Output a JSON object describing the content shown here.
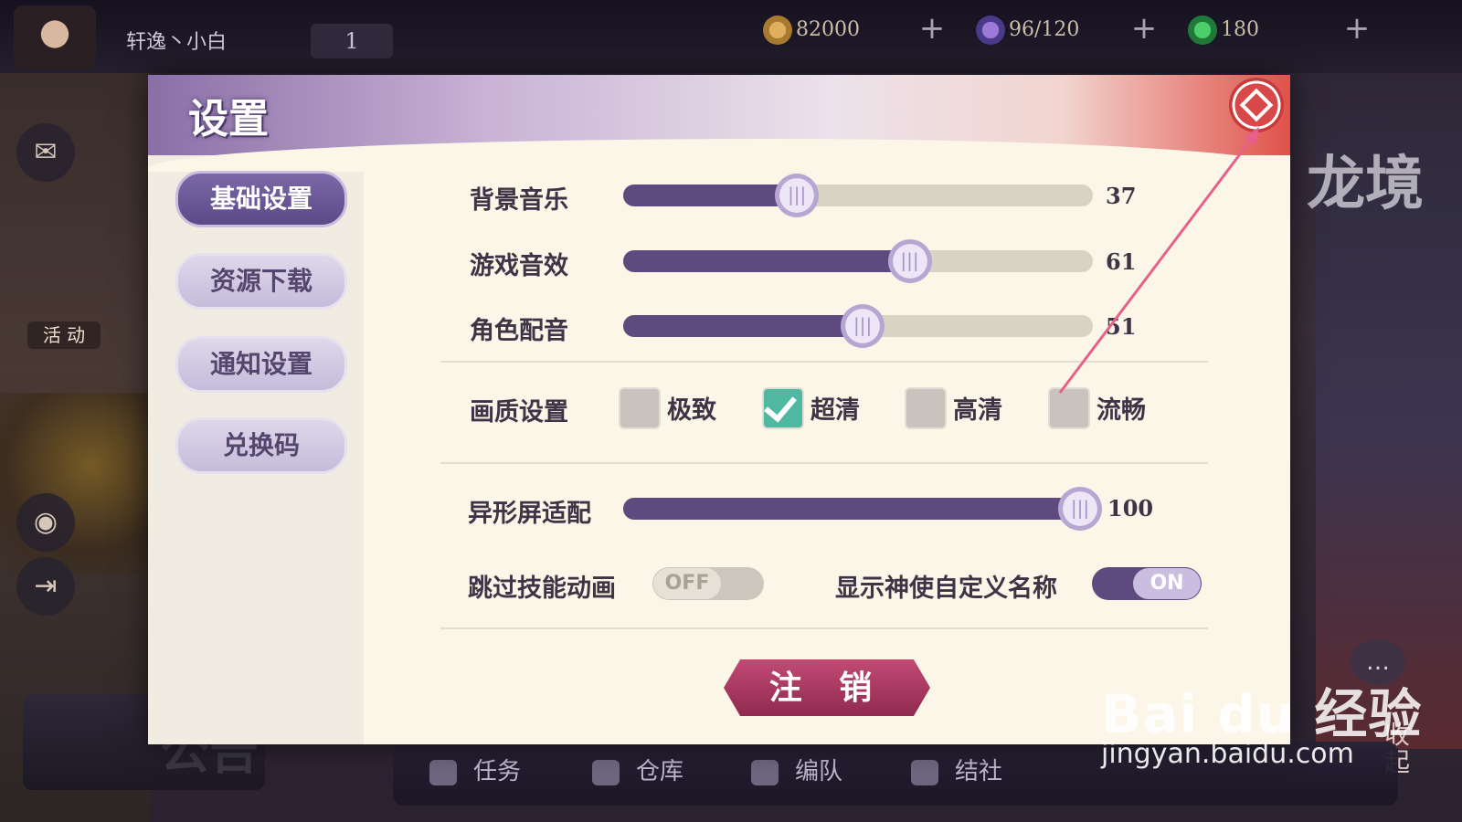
{
  "top": {
    "player_name": "轩逸丶小白",
    "level": "1",
    "gold": "82000",
    "stamina": "96/120",
    "gems": "180",
    "plus": "+"
  },
  "left_panel": {
    "activity_label": "活 动"
  },
  "dialog": {
    "title": "设置",
    "close_icon": "close-icon",
    "tabs": [
      {
        "label": "基础设置",
        "active": true
      },
      {
        "label": "资源下载",
        "active": false
      },
      {
        "label": "通知设置",
        "active": false
      },
      {
        "label": "兑换码",
        "active": false
      }
    ],
    "audio": [
      {
        "label": "背景音乐",
        "value": "37",
        "level": 37
      },
      {
        "label": "游戏音效",
        "value": "61",
        "level": 61
      },
      {
        "label": "角色配音",
        "value": "51",
        "level": 51
      }
    ],
    "quality": {
      "label": "画质设置",
      "options": [
        {
          "label": "极致",
          "checked": false
        },
        {
          "label": "超清",
          "checked": true
        },
        {
          "label": "高清",
          "checked": false
        },
        {
          "label": "流畅",
          "checked": false
        }
      ]
    },
    "notch": {
      "label": "异形屏适配",
      "value": "100",
      "level": 100
    },
    "skip_skill": {
      "label": "跳过技能动画",
      "state": "OFF"
    },
    "show_name": {
      "label": "显示神使自定义名称",
      "state": "ON"
    },
    "logout_label": "注 销"
  },
  "right_panel": {
    "banner": "龙境",
    "collapse": "收起"
  },
  "bottom_nav": [
    "任务",
    "仓库",
    "编队",
    "结社"
  ],
  "notice": "公告",
  "watermark": {
    "logo": "Bai du 经验",
    "url": "jingyan.baidu.com"
  },
  "colors": {
    "accent": "#5e4a7e",
    "close": "#d84848",
    "logout": "#b03c64",
    "checked": "#4fb8a0"
  }
}
